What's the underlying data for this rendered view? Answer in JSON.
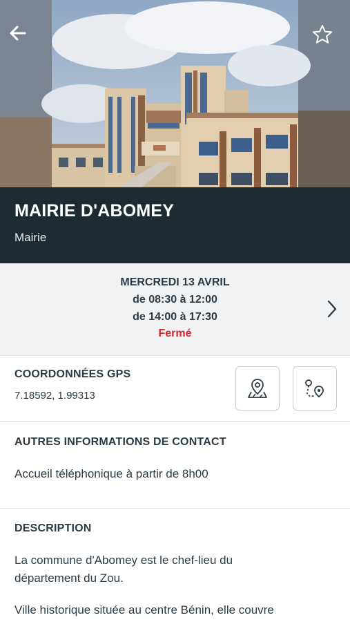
{
  "header": {
    "title": "MAIRIE D'ABOMEY",
    "category": "Mairie",
    "back_icon": "arrow-left-icon",
    "favorite_icon": "star-outline-icon"
  },
  "hours": {
    "day": "MERCREDI 13 AVRIL",
    "slot1": "de 08:30 à 12:00",
    "slot2": "de 14:00 à 17:30",
    "status": "Fermé",
    "status_color": "#d9262b",
    "chevron_icon": "chevron-right-icon"
  },
  "gps": {
    "heading": "COORDONNÉES GPS",
    "value": "7.18592, 1.99313",
    "map_icon": "map-pin-icon",
    "route_icon": "route-icon"
  },
  "contact": {
    "heading": "AUTRES INFORMATIONS DE CONTACT",
    "text": "Accueil téléphonique à partir de 8h00"
  },
  "description": {
    "heading": "DESCRIPTION",
    "line1": "La commune d'Abomey est le chef-lieu du",
    "line2": "département du Zou.",
    "line3": "Ville historique située au centre Bénin, elle couvre"
  },
  "colors": {
    "title_band": "#1d2b33",
    "hours_bg": "#f1f2f4",
    "text": "#2b3a44"
  }
}
